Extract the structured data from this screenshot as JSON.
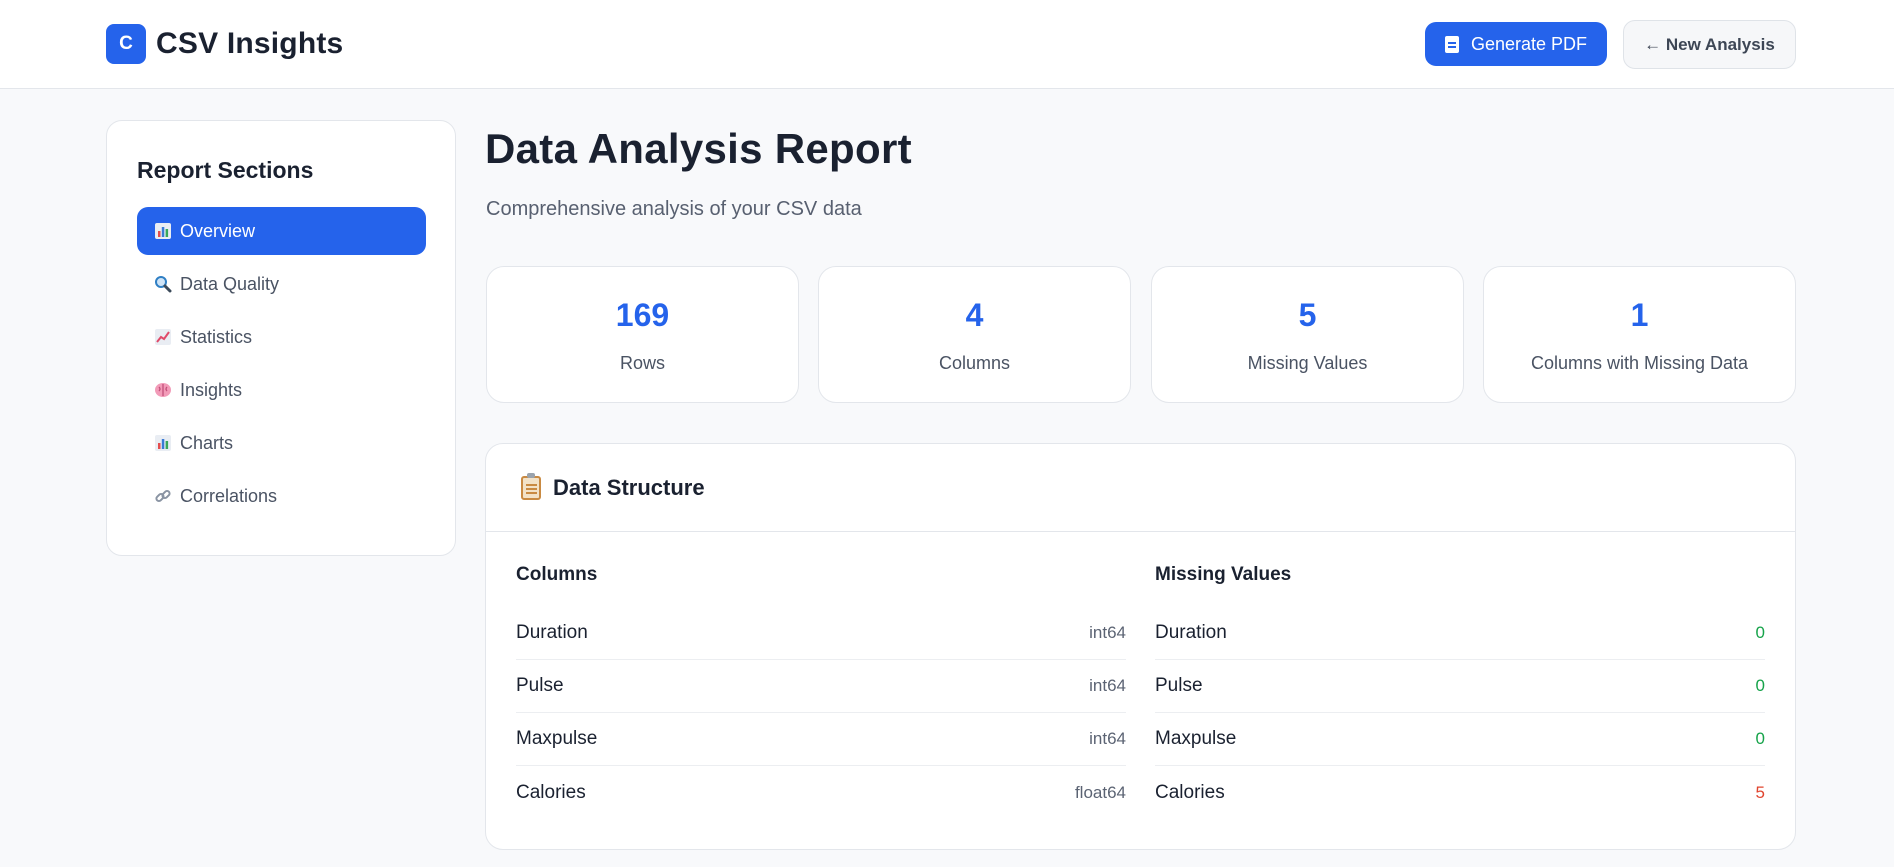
{
  "header": {
    "logo_letter": "C",
    "app_title": "CSV Insights",
    "pdf_button": "Generate PDF",
    "new_button": "← New Analysis"
  },
  "sidebar": {
    "title": "Report Sections",
    "items": [
      {
        "label": "Overview",
        "icon": "bar-chart-icon",
        "active": true
      },
      {
        "label": "Data Quality",
        "icon": "magnifier-icon",
        "active": false
      },
      {
        "label": "Statistics",
        "icon": "trend-chart-icon",
        "active": false
      },
      {
        "label": "Insights",
        "icon": "brain-icon",
        "active": false
      },
      {
        "label": "Charts",
        "icon": "bar-chart-icon",
        "active": false
      },
      {
        "label": "Correlations",
        "icon": "link-icon",
        "active": false
      }
    ]
  },
  "main": {
    "title": "Data Analysis Report",
    "subtitle": "Comprehensive analysis of your CSV data",
    "stats": [
      {
        "value": "169",
        "label": "Rows"
      },
      {
        "value": "4",
        "label": "Columns"
      },
      {
        "value": "5",
        "label": "Missing Values"
      },
      {
        "value": "1",
        "label": "Columns with Missing Data"
      }
    ],
    "data_structure": {
      "title": "Data Structure",
      "icon": "clipboard-icon",
      "columns_title": "Columns",
      "columns": [
        {
          "name": "Duration",
          "type": "int64"
        },
        {
          "name": "Pulse",
          "type": "int64"
        },
        {
          "name": "Maxpulse",
          "type": "int64"
        },
        {
          "name": "Calories",
          "type": "float64"
        }
      ],
      "missing_title": "Missing Values",
      "missing": [
        {
          "name": "Duration",
          "count": "0"
        },
        {
          "name": "Pulse",
          "count": "0"
        },
        {
          "name": "Maxpulse",
          "count": "0"
        },
        {
          "name": "Calories",
          "count": "5"
        }
      ]
    }
  },
  "colors": {
    "accent": "#2563eb",
    "ok": "#16a34a",
    "warn": "#e0452f"
  }
}
